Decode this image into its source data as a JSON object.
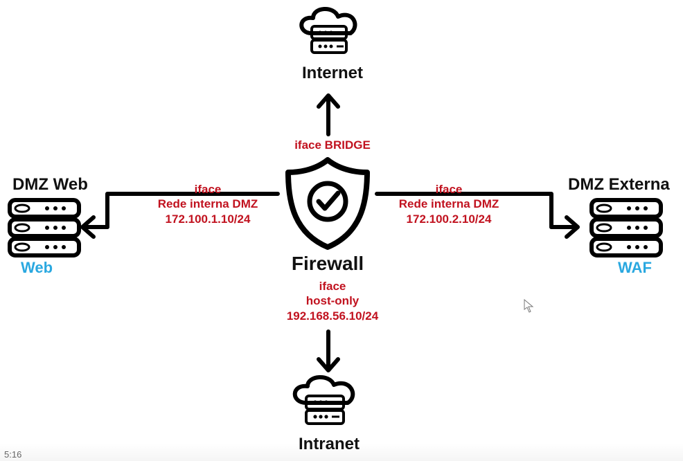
{
  "center": {
    "label": "Firewall"
  },
  "nodes": {
    "top": {
      "label": "Internet"
    },
    "bottom": {
      "label": "Intranet"
    },
    "left": {
      "label": "DMZ Web",
      "sublabel": "Web"
    },
    "right": {
      "label": "DMZ Externa",
      "sublabel": "WAF"
    }
  },
  "interfaces": {
    "top": {
      "line1": "iface BRIDGE"
    },
    "bottom": {
      "line1": "iface",
      "line2": "host-only",
      "line3": "192.168.56.10/24"
    },
    "left": {
      "line1": "iface",
      "line2": "Rede interna DMZ",
      "line3": "172.100.1.10/24"
    },
    "right": {
      "line1": "iface",
      "line2": "Rede interna DMZ",
      "line3": "172.100.2.10/24"
    }
  },
  "footer": {
    "time": "5:16"
  }
}
